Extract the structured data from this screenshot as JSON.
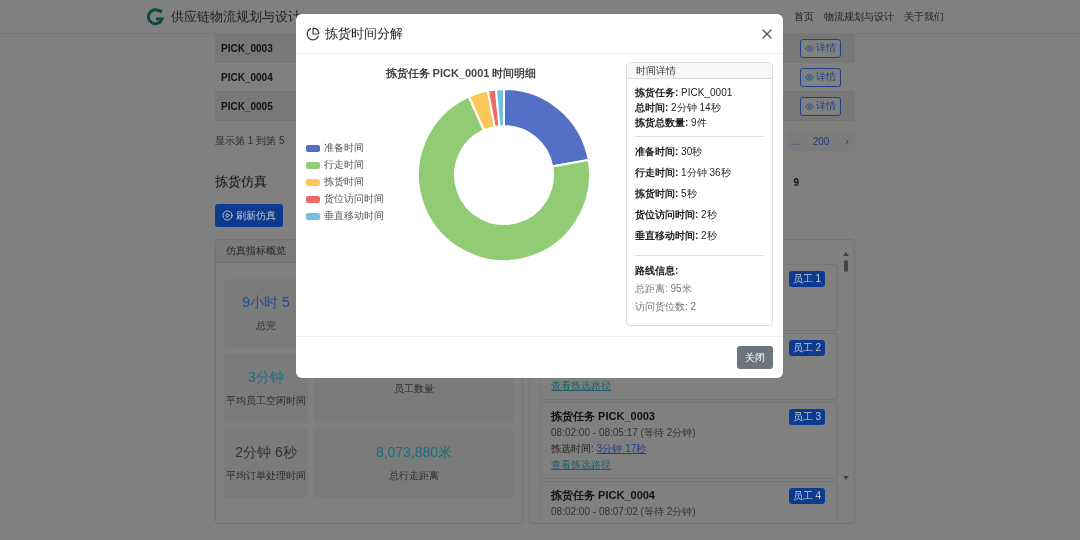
{
  "navbar": {
    "brand": "供应链物流规划与设计",
    "links": [
      "首页",
      "物流规划与设计",
      "关于我们"
    ]
  },
  "table_rows": [
    {
      "id": "PICK_0003",
      "action": "详情"
    },
    {
      "id": "PICK_0004",
      "action": "详情"
    },
    {
      "id": "PICK_0005",
      "action": "详情"
    }
  ],
  "pagination": {
    "summary": "显示第 1 到第 5",
    "pages": [
      "...",
      "200",
      "›"
    ]
  },
  "simulation": {
    "heading": "拣货仿真",
    "side_value": "9",
    "refresh_button": "刷新仿真",
    "overview": {
      "title": "仿真指标概览",
      "stats": [
        {
          "value": "9小时 5",
          "label": "总完",
          "color": "#1f4b99"
        },
        {
          "value": "3分钟",
          "label": "平均员工空闲时间",
          "color": "#1d6f7c"
        },
        {
          "label": "员工数量"
        },
        {
          "value": "2分钟 6秒",
          "label": "平均订单处理时间",
          "color": "#333333"
        },
        {
          "value": "8,073,880米",
          "label": "总行走距离",
          "color": "#1d6f7c"
        }
      ]
    },
    "tasks": [
      {
        "badge": "员工 1"
      },
      {
        "badge": "员工 2",
        "route_link": "查看拣选路径"
      },
      {
        "title": "拣货任务 PICK_0003",
        "time": "08:02:00 - 08:05:17 (等待 2分钟)",
        "pick_label": "拣选时间:",
        "pick_value": "3分钟 17秒",
        "route_link": "查看拣选路径",
        "badge": "员工 3"
      },
      {
        "title": "拣货任务 PICK_0004",
        "time": "08:02:00 - 08:07:02 (等待 2分钟)",
        "badge": "员工 4"
      }
    ]
  },
  "modal": {
    "title": "拣货时间分解",
    "close_button": "关闭",
    "chart_data": {
      "type": "donut",
      "title": "拣货任务 PICK_0001 时间明细",
      "categories": [
        "准备时间",
        "行走时间",
        "拣货时间",
        "货位访问时间",
        "垂直移动时间"
      ],
      "values": [
        22.2,
        71.1,
        3.7,
        1.5,
        1.5
      ],
      "colors": [
        "#5470c6",
        "#91cc75",
        "#fac858",
        "#ee6666",
        "#73c0de"
      ]
    },
    "detail": {
      "title": "时间详情",
      "summary": [
        "**拣货任务:** PICK_0001",
        "**总时间:** 2分钟 14秒",
        "**拣货总数量:** 9件"
      ],
      "times": [
        "**准备时间:** 30秒",
        "**行走时间:** 1分钟 36秒",
        "**拣货时间:** 5秒",
        "**货位访问时间:** 2秒",
        "**垂直移动时间:** 2秒"
      ],
      "route": {
        "title": "路线信息:",
        "lines": [
          "总距离: 95米",
          "访问货位数: 2"
        ]
      }
    }
  }
}
